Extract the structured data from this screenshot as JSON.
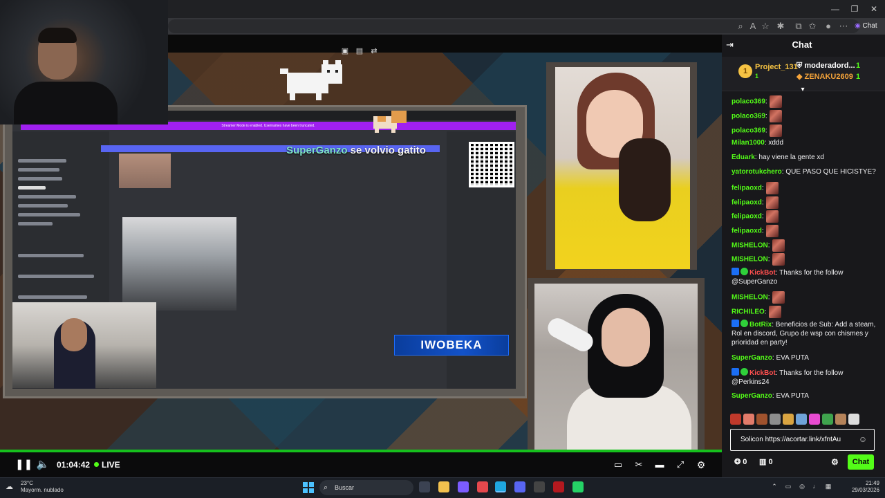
{
  "browser": {
    "window_controls": [
      "—",
      "❐",
      "✕"
    ],
    "toolbar_icons": [
      "zoom-icon",
      "read-aloud-icon",
      "favorite-icon",
      "extensions-icon",
      "split-icon",
      "favorites-bar-icon",
      "profile-icon",
      "more-icon"
    ],
    "copilot_label": "Chat"
  },
  "video": {
    "overlay_caption": {
      "highlight": "SuperGanzo",
      "rest": " se volvio gatito"
    },
    "name_banner": "IWOBEKA",
    "discord_banner": "Streamer Mode is enabled. Usernames have been truncated.",
    "discord_channels": [
      "General",
      "Debates",
      "Cartelera",
      "Clips",
      "Noche-de-terror",
      "Zona-otaku",
      "Solicitud-de-unban",
      "Memes"
    ],
    "controls": {
      "time": "01:04:42",
      "live_label": "LIVE",
      "progress": 1.0
    }
  },
  "chat": {
    "title": "Chat",
    "leaderboard": [
      {
        "rank": "1",
        "name": "Project_131",
        "count": "1",
        "color": "#f6c343"
      },
      {
        "name": "moderadord...",
        "count": "1",
        "color": "#ffffff"
      },
      {
        "name": "ZENAKU2609",
        "count": "1",
        "color": "#f6a43a"
      }
    ],
    "messages": [
      {
        "user": "polaco369",
        "color": "#53fc18",
        "text": "",
        "emote": true
      },
      {
        "user": "polaco369",
        "color": "#53fc18",
        "text": "",
        "emote": true
      },
      {
        "user": "polaco369",
        "color": "#53fc18",
        "text": "",
        "emote": true
      },
      {
        "user": "Milan1000",
        "color": "#53fc18",
        "text": " xddd"
      },
      {
        "user": "Eduark",
        "color": "#53fc18",
        "text": " hay viene la gente xd"
      },
      {
        "user": "yatorotukchero",
        "color": "#53fc18",
        "text": " QUE PASO QUE HICISTYE?"
      },
      {
        "user": "felipaoxd",
        "color": "#53fc18",
        "text": "",
        "emote": true
      },
      {
        "user": "felipaoxd",
        "color": "#53fc18",
        "text": "",
        "emote": true
      },
      {
        "user": "felipaoxd",
        "color": "#53fc18",
        "text": "",
        "emote": true
      },
      {
        "user": "felipaoxd",
        "color": "#53fc18",
        "text": "",
        "emote": true
      },
      {
        "user": "MISHELON",
        "color": "#53fc18",
        "text": "",
        "emote": true
      },
      {
        "user": "MISHELON",
        "color": "#53fc18",
        "text": "",
        "emote": true
      },
      {
        "user": "KickBot",
        "color": "#ff4f4f",
        "text": " Thanks for the follow @SuperGanzo",
        "bot": true
      },
      {
        "user": "MISHELON",
        "color": "#53fc18",
        "text": "",
        "emote": true
      },
      {
        "user": "RICHILEO",
        "color": "#53fc18",
        "text": "",
        "emote": true
      },
      {
        "user": "BotRix",
        "color": "#53fc18",
        "text": " Beneficios de Sub: Add a steam, Rol en discord, Grupo de wsp con chismes y prioridad en party!",
        "bot": true
      },
      {
        "user": "SuperGanzo",
        "color": "#53fc18",
        "text": " EVA PUTA"
      },
      {
        "user": "KickBot",
        "color": "#ff4f4f",
        "text": " Thanks for the follow @Perkins24",
        "bot": true
      },
      {
        "user": "SuperGanzo",
        "color": "#53fc18",
        "text": " EVA PUTA"
      }
    ],
    "input_value": "Solicon https://acortar.link/xfntAu",
    "footer": {
      "kicks": "0",
      "sub_gifts": "0",
      "send_label": "Chat"
    }
  },
  "taskbar": {
    "weather_temp": "23°C",
    "weather_desc": "Mayorm. nublado",
    "search_placeholder": "Buscar",
    "time": "21:49",
    "date": "29/03/2026"
  }
}
